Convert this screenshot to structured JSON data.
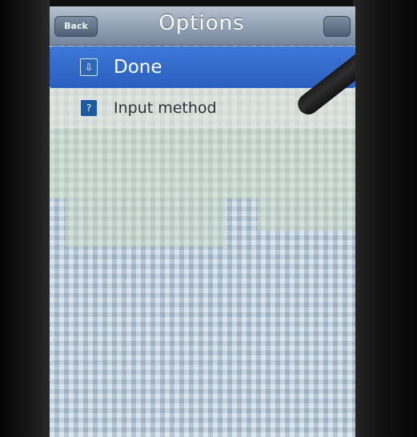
{
  "navbar": {
    "back_label": "Back",
    "title": "Options"
  },
  "menu": {
    "items": [
      {
        "label": "Done",
        "icon": "tray-icon",
        "icon_glyph": "⇩",
        "selected": true
      },
      {
        "label": "Input method",
        "icon": "question-icon",
        "icon_glyph": "?",
        "selected": false
      }
    ]
  },
  "colors": {
    "selection": "#2f67c8",
    "navbar": "#8fa0b2",
    "screen_pattern_blue": "#bcd0dd",
    "screen_pattern_green": "#c9d8c2"
  }
}
